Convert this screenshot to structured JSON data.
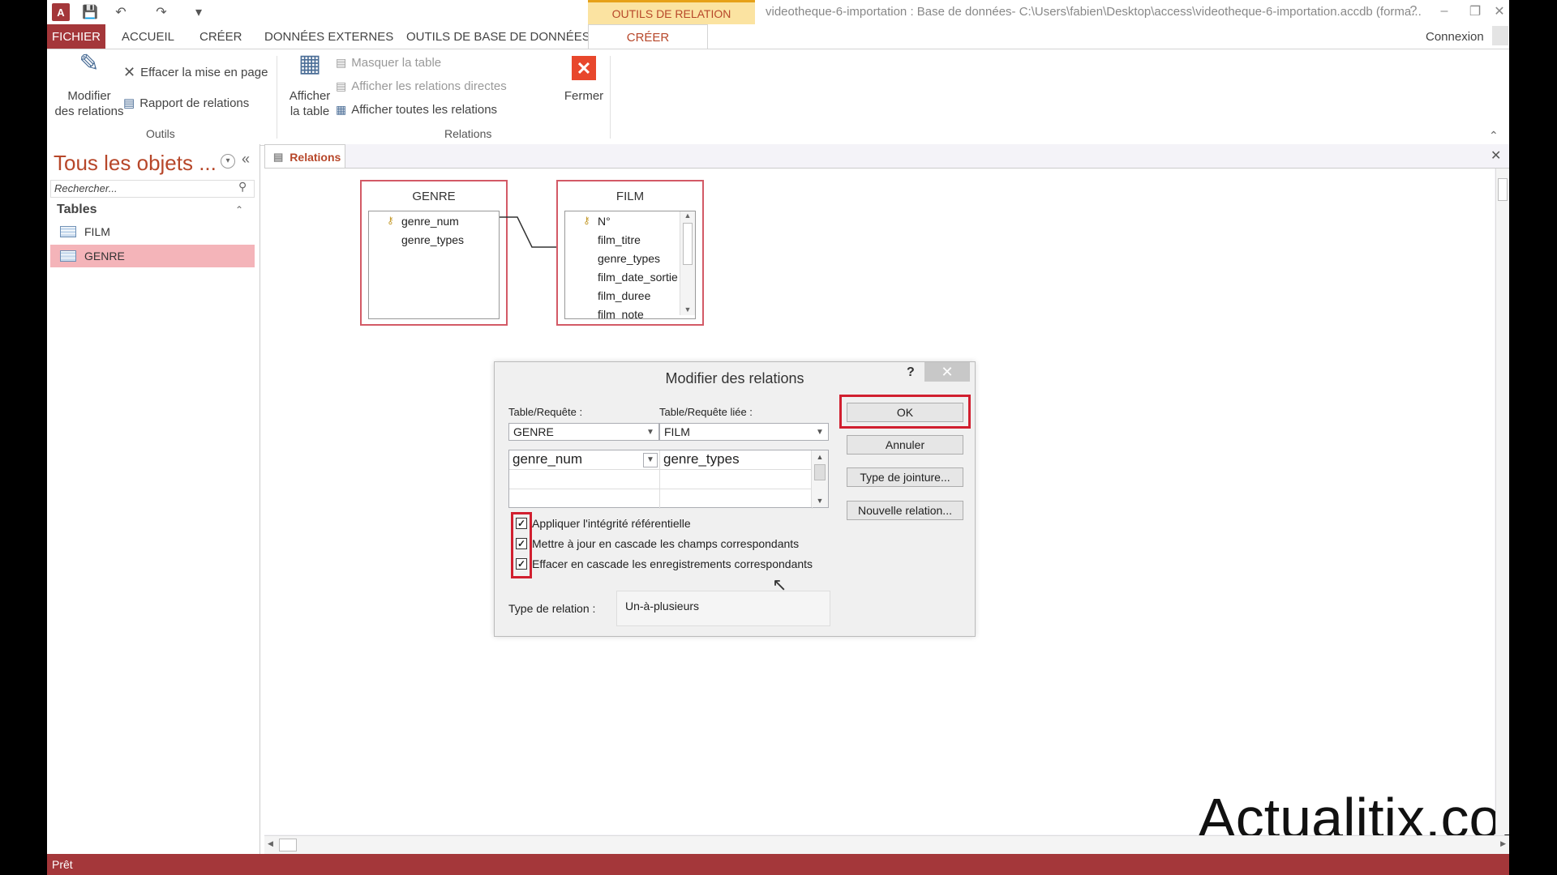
{
  "window": {
    "context_tab": "OUTILS DE RELATION",
    "title": "videotheque-6-importation : Base de données- C:\\Users\\fabien\\Desktop\\access\\videotheque-6-importation.accdb (forma...",
    "help": "?",
    "connexion": "Connexion"
  },
  "ribbon_tabs": {
    "fichier": "FICHIER",
    "accueil": "ACCUEIL",
    "creer": "CRÉER",
    "donnees_externes": "DONNÉES EXTERNES",
    "outils_bd": "OUTILS DE BASE DE DONNÉES",
    "creer_context": "CRÉER"
  },
  "ribbon": {
    "modifier_l1": "Modifier",
    "modifier_l2": "des relations",
    "effacer": "Effacer la mise en page",
    "rapport": "Rapport de relations",
    "group_outils": "Outils",
    "afficher_l1": "Afficher",
    "afficher_l2": "la table",
    "masquer": "Masquer la table",
    "directes": "Afficher les relations directes",
    "toutes": "Afficher toutes les relations",
    "fermer": "Fermer",
    "group_relations": "Relations"
  },
  "nav": {
    "title": "Tous les objets ...",
    "search_placeholder": "Rechercher...",
    "group": "Tables",
    "items": [
      {
        "label": "FILM",
        "selected": false
      },
      {
        "label": "GENRE",
        "selected": true
      }
    ]
  },
  "doc": {
    "tab": "Relations"
  },
  "tables": {
    "genre": {
      "title": "GENRE",
      "fields": [
        "genre_num",
        "genre_types"
      ],
      "key_field": "genre_num"
    },
    "film": {
      "title": "FILM",
      "fields": [
        "N°",
        "film_titre",
        "genre_types",
        "film_date_sortie",
        "film_duree",
        "film_note"
      ],
      "key_field": "N°"
    }
  },
  "dialog": {
    "title": "Modifier des relations",
    "help": "?",
    "label_table": "Table/Requête :",
    "label_linked": "Table/Requête liée :",
    "table_value": "GENRE",
    "linked_value": "FILM",
    "field_left": "genre_num",
    "field_right": "genre_types",
    "btn_ok": "OK",
    "btn_annuler": "Annuler",
    "btn_jointure": "Type de jointure...",
    "btn_nouvelle": "Nouvelle relation...",
    "chk_integrite": "Appliquer l'intégrité référentielle",
    "chk_maj": "Mettre à jour en cascade les champs correspondants",
    "chk_effacer": "Effacer en cascade les enregistrements correspondants",
    "checks": [
      true,
      true,
      true
    ],
    "label_reltype": "Type de relation :",
    "reltype_value": "Un-à-plusieurs"
  },
  "status": "Prêt",
  "watermark": "Actualitix.com",
  "colors": {
    "accent": "#a4373a",
    "highlight": "#d11f2f",
    "selected": "#f4b4b9"
  }
}
